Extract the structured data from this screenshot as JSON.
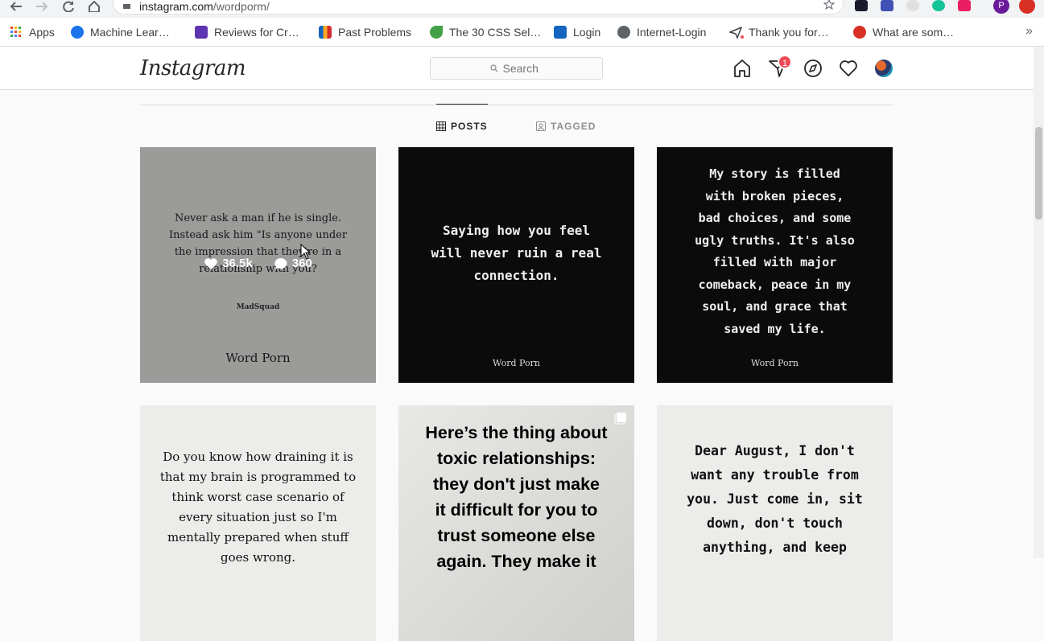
{
  "browser": {
    "url_host": "instagram.com",
    "url_path": "/wordporm/",
    "bookmarks": [
      {
        "label": "Apps",
        "color": "#ea4335"
      },
      {
        "label": "Machine Lear…",
        "color": "#1a73e8"
      },
      {
        "label": "Reviews for Cr…",
        "color": "#5e35b1"
      },
      {
        "label": "Past Problems",
        "color": "#f9a825"
      },
      {
        "label": "The 30 CSS Sel…",
        "color": "#43a047"
      },
      {
        "label": "Login",
        "color": "#1565c0"
      },
      {
        "label": "Internet-Login",
        "color": "#5f6368"
      },
      {
        "label": "Thank you for…",
        "color": "#3c4043"
      },
      {
        "label": "What are som…",
        "color": "#d93025"
      }
    ],
    "profile_initial": "P"
  },
  "header": {
    "logo": "Instagram",
    "search_placeholder": "Search",
    "notification_count": "1"
  },
  "tabs": [
    {
      "label": "POSTS",
      "icon": "grid-icon",
      "active": true
    },
    {
      "label": "TAGGED",
      "icon": "tag-icon",
      "active": false
    }
  ],
  "posts": [
    {
      "text": "Never ask a man if he is single.\nInstead ask him \"Is anyone under\nthe impression that they're in a\nrelationship with you?",
      "sub": "MadSquad",
      "caption": "Word Porn",
      "likes": "36.5k",
      "comments": "360"
    },
    {
      "text": "Saying how you feel\nwill never ruin a real\nconnection.",
      "caption": "Word Porn"
    },
    {
      "text": "My story is filled\nwith broken pieces,\nbad choices, and some\nugly truths. It's also\nfilled with major\ncomeback, peace in my\nsoul, and grace that\nsaved my life.",
      "caption": "Word Porn"
    },
    {
      "text": "Do you know how draining it is\nthat my brain is programmed to\nthink worst case scenario of\nevery situation just so I'm\nmentally prepared when stuff\ngoes wrong."
    },
    {
      "text": "Here’s the thing about\ntoxic relationships:\nthey don't just make\nit difficult for you to\ntrust someone else\nagain. They make it"
    },
    {
      "text": "Dear August, I don't\nwant any trouble from\nyou. Just come in, sit\ndown, don't touch\nanything, and keep"
    }
  ]
}
